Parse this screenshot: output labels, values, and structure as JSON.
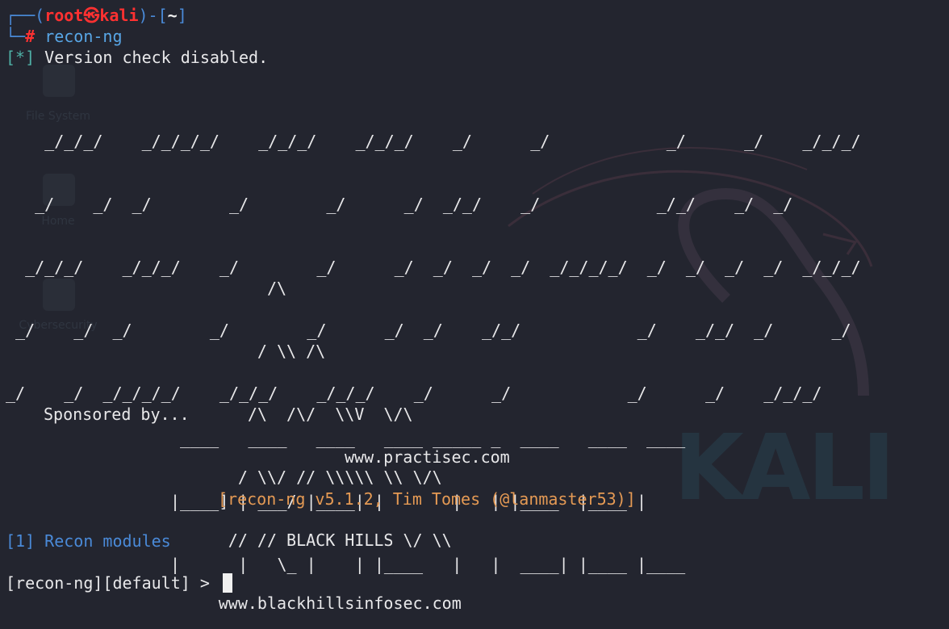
{
  "prompt_header": {
    "open": "┌──(",
    "user": "root",
    "at_symbol": "㉿",
    "host": "kali",
    "mid": ")-[",
    "path": "~",
    "close": "]",
    "corner": "└─",
    "hash": "#",
    "command": "recon-ng"
  },
  "version_line": {
    "marker": "[*]",
    "text": "Version check disabled."
  },
  "banner": {
    "recon_ascii": [
      "    _/_/_/    _/_/_/_/    _/_/_/    _/_/_/    _/      _/            _/      _/    _/_/_/",
      "   _/    _/  _/        _/        _/      _/  _/_/    _/            _/_/    _/  _/",
      "  _/_/_/    _/_/_/    _/        _/      _/  _/  _/  _/  _/_/_/_/  _/  _/  _/  _/  _/_/_/",
      " _/    _/  _/        _/        _/      _/  _/    _/_/            _/    _/_/  _/      _/",
      "_/    _/  _/_/_/_/    _/_/_/    _/_/_/    _/      _/            _/      _/    _/_/_/"
    ],
    "sponsored_by": "Sponsored by...",
    "bhis_ascii": [
      "                       /\\",
      "                      / \\\\ /\\",
      "Sponsored by...      /\\  /\\/  \\\\V  \\/\\",
      "                    / \\\\/ // \\\\\\\\\\ \\\\ \\/\\",
      "                   // // BLACK HILLS \\/ \\\\",
      "                  www.blackhillsinfosec.com"
    ],
    "practisec_ascii": [
      " ____   ____   ____   ____ _____ _  ____   ____  ____",
      "|____] | ___/ |____| |       |   | |____  |____ |",
      "|      |   \\_ |    | |____   |   |  ____| |____ |____"
    ],
    "practisec_url": "www.practisec.com",
    "version": "[recon-ng v5.1.2, Tim Tomes (@lanmaster53)]"
  },
  "modules": {
    "index": "[1]",
    "label": "Recon modules"
  },
  "console_prompt": "[recon-ng][default] > ",
  "desktop": {
    "icons": [
      {
        "name": "File System"
      },
      {
        "name": "Home"
      },
      {
        "name": "Cybersecurity"
      }
    ],
    "watermark": "KALI"
  },
  "colors": {
    "background": "#23252f",
    "prompt_blue": "#4a8ad8",
    "root_red": "#ff3131",
    "info_cyan": "#4fb0a6",
    "version_orange": "#e59a54"
  }
}
